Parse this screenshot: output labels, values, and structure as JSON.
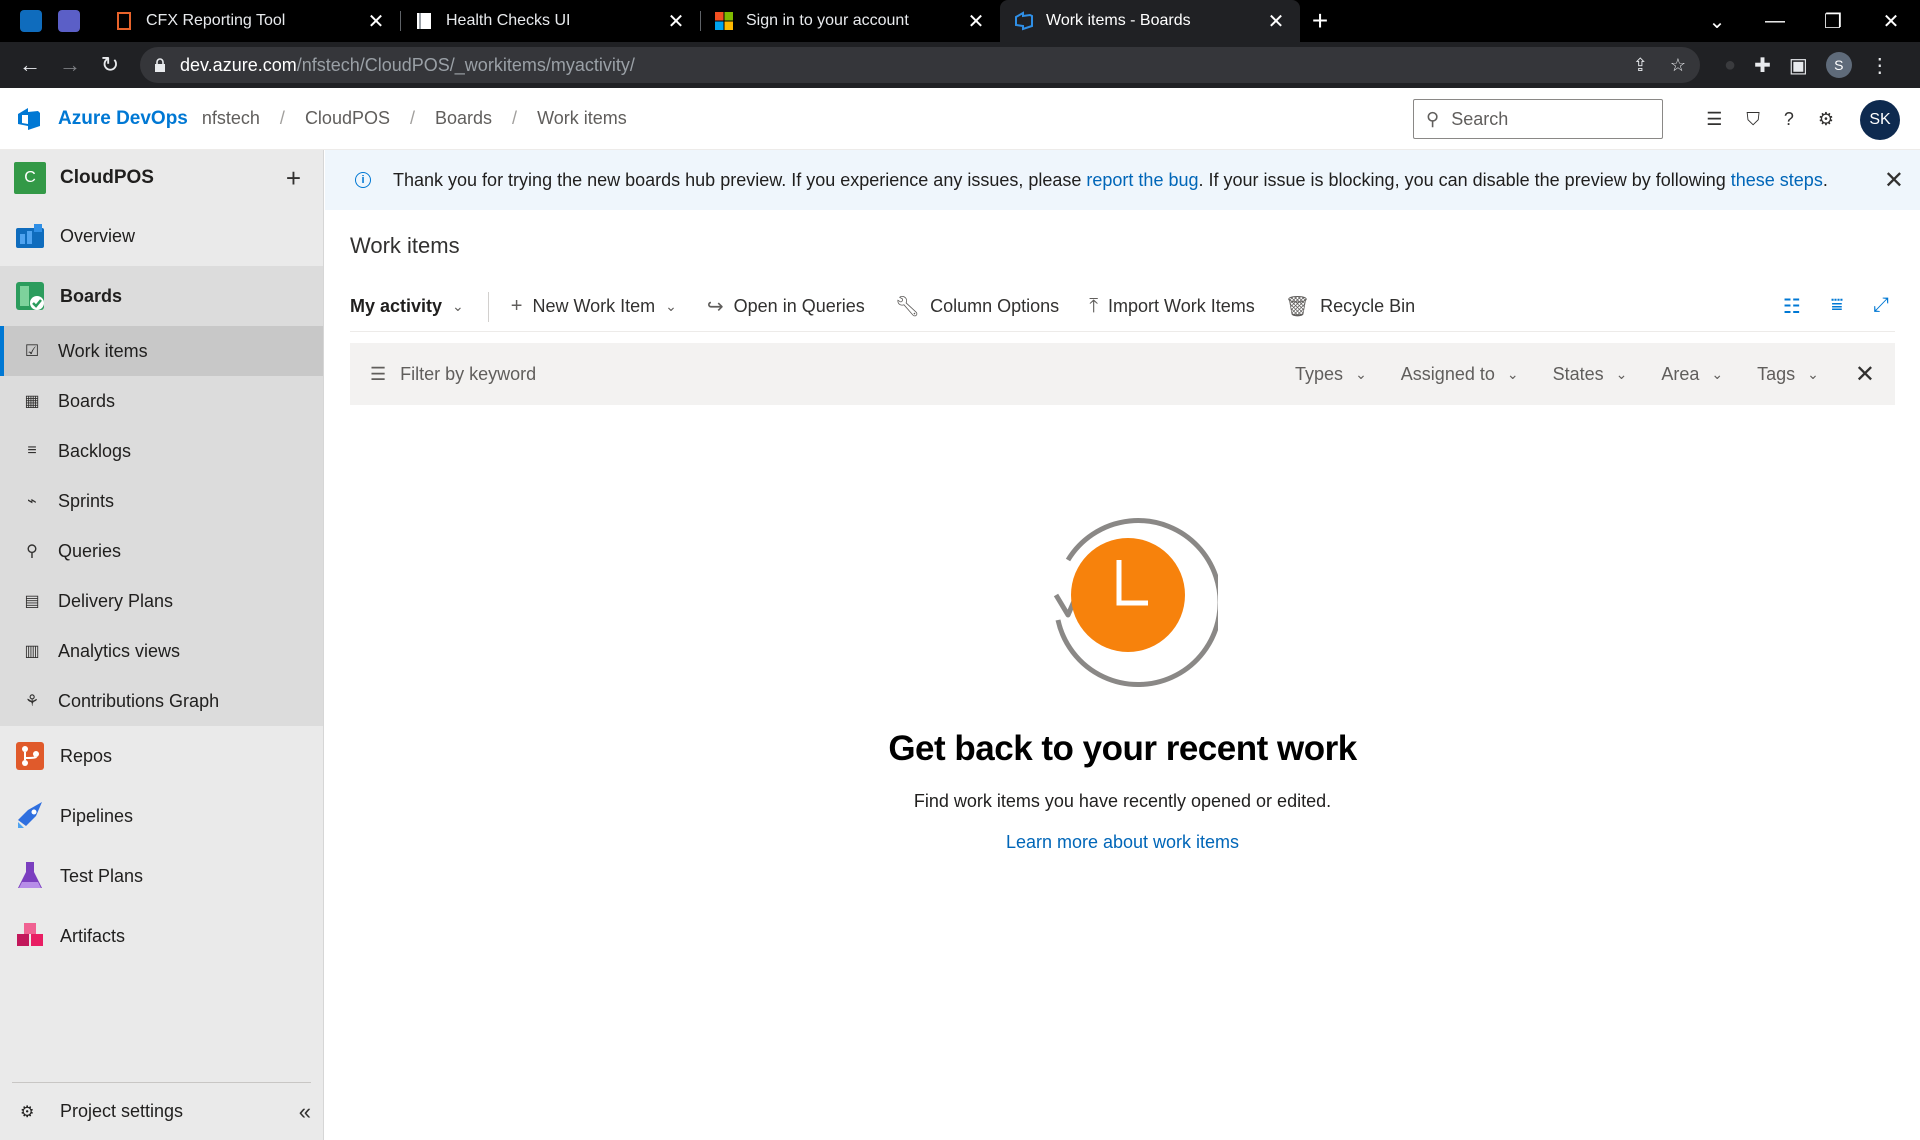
{
  "browser": {
    "pinned_tabs": [
      {
        "icon": "outlook-icon",
        "color": "#0f6cbd"
      },
      {
        "icon": "teams-icon",
        "color": "#5b5fc7"
      }
    ],
    "tabs": [
      {
        "title": "CFX Reporting Tool",
        "icon": "document-icon",
        "active": false
      },
      {
        "title": "Health Checks UI",
        "icon": "page-icon",
        "active": false
      },
      {
        "title": "Sign in to your account",
        "icon": "microsoft-logo-icon",
        "active": false
      },
      {
        "title": "Work items - Boards",
        "icon": "azure-devops-icon",
        "active": true
      }
    ],
    "url_host": "dev.azure.com",
    "url_path": "/nfstech/CloudPOS/_workitems/myactivity/",
    "profile_initial": "S"
  },
  "header": {
    "brand": "Azure DevOps",
    "breadcrumb": [
      "nfstech",
      "CloudPOS",
      "Boards",
      "Work items"
    ],
    "search_placeholder": "Search",
    "avatar_initials": "SK"
  },
  "sidebar": {
    "project_initial": "C",
    "project_name": "CloudPOS",
    "project_color": "#339947",
    "overview": "Overview",
    "boards": "Boards",
    "boards_sub": [
      {
        "label": "Work items",
        "icon": "work-items-icon",
        "selected": true
      },
      {
        "label": "Boards",
        "icon": "boards-grid-icon"
      },
      {
        "label": "Backlogs",
        "icon": "backlogs-icon"
      },
      {
        "label": "Sprints",
        "icon": "sprints-icon"
      },
      {
        "label": "Queries",
        "icon": "queries-icon"
      },
      {
        "label": "Delivery Plans",
        "icon": "delivery-plans-icon"
      },
      {
        "label": "Analytics views",
        "icon": "analytics-icon"
      },
      {
        "label": "Contributions Graph",
        "icon": "contributions-icon"
      }
    ],
    "repos": "Repos",
    "pipelines": "Pipelines",
    "test_plans": "Test Plans",
    "artifacts": "Artifacts",
    "project_settings": "Project settings"
  },
  "banner": {
    "text_1": "Thank you for trying the new boards hub preview. If you experience any issues, please ",
    "link_1": "report the bug",
    "text_2": ". If your issue is blocking, you can disable the preview by following ",
    "link_2": "these steps",
    "text_3": "."
  },
  "main": {
    "title": "Work items",
    "pivot": "My activity",
    "toolbar": {
      "new_work_item": "New Work Item",
      "open_in_queries": "Open in Queries",
      "column_options": "Column Options",
      "import_work_items": "Import Work Items",
      "recycle_bin": "Recycle Bin"
    },
    "filter": {
      "placeholder": "Filter by keyword",
      "types": "Types",
      "assigned_to": "Assigned to",
      "states": "States",
      "area": "Area",
      "tags": "Tags"
    },
    "empty": {
      "title": "Get back to your recent work",
      "subtitle": "Find work items you have recently opened or edited.",
      "link": "Learn more about work items"
    }
  },
  "colors": {
    "accent": "#0078d4",
    "clock_orange": "#f7820c"
  }
}
